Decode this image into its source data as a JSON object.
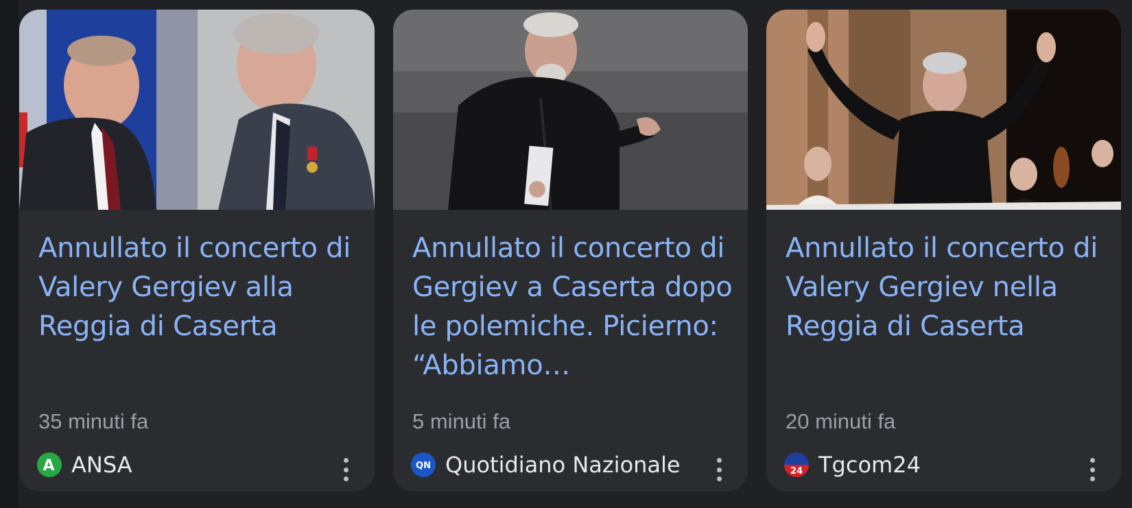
{
  "colors": {
    "background": "#202124",
    "card": "#2b2c2f",
    "headline": "#8ab4f8",
    "meta": "#9aa0a6",
    "source": "#e8eaed"
  },
  "cards": [
    {
      "headline": "Annullato il concerto di Valery Gergiev alla Reggia di Caserta",
      "time": "35 minuti fa",
      "source": "ANSA",
      "logo_icon": "ansa-logo-icon",
      "logo_text": "A"
    },
    {
      "headline": "Annullato il concerto di Gergiev a Caserta dopo le polemiche. Picierno: “Abbiamo…",
      "time": "5 minuti fa",
      "source": "Quotidiano Nazionale",
      "logo_icon": "qn-logo-icon",
      "logo_text": "QN"
    },
    {
      "headline": "Annullato il concerto di Valery Gergiev nella Reggia di Caserta",
      "time": "20 minuti fa",
      "source": "Tgcom24",
      "logo_icon": "tgcom24-logo-icon",
      "logo_text": "24"
    }
  ]
}
